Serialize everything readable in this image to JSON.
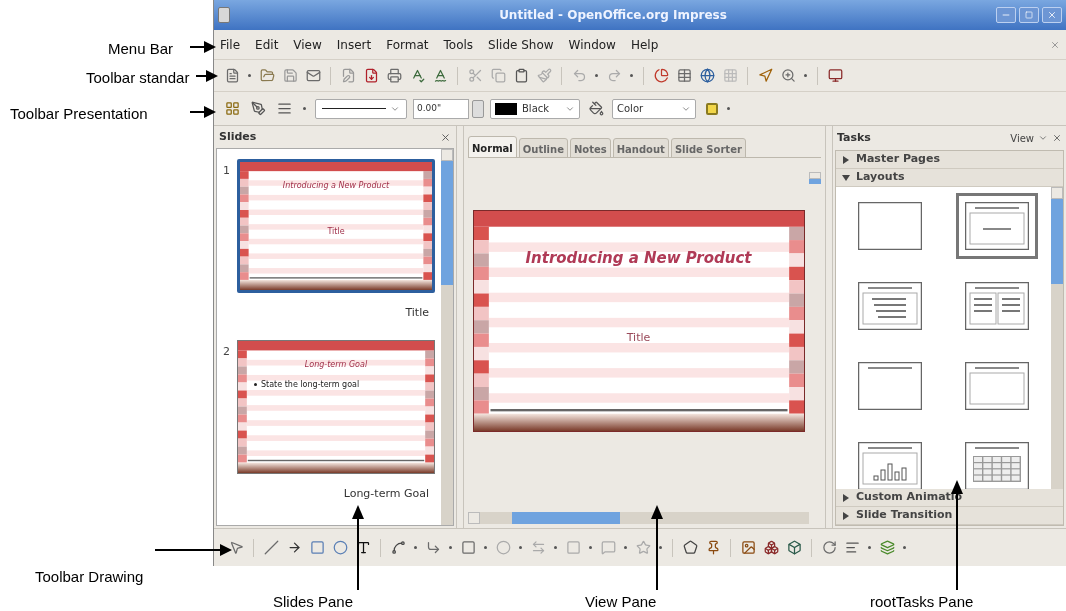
{
  "annotations": [
    {
      "label": "Menu Bar",
      "kind": "right"
    },
    {
      "label": "Toolbar standar",
      "kind": "right"
    },
    {
      "label": "Toolbar Presentation",
      "kind": "right"
    },
    {
      "label": "Toolbar Drawing",
      "kind": "right"
    },
    {
      "label": "Slides Pane",
      "kind": "up"
    },
    {
      "label": "View Pane",
      "kind": "up"
    },
    {
      "label": "rootTasks Pane",
      "kind": "up"
    }
  ],
  "window": {
    "title": "Untitled - OpenOffice.org Impress"
  },
  "menu": [
    "File",
    "Edit",
    "View",
    "Insert",
    "Format",
    "Tools",
    "Slide Show",
    "Window",
    "Help"
  ],
  "toolbar_presentation": {
    "line_width": "0.00\"",
    "line_color": "Black",
    "area_style": "Color"
  },
  "slides_pane": {
    "title": "Slides",
    "slides": [
      {
        "number": "1",
        "title": "Introducing a New Product",
        "body": "Title",
        "label": "Title",
        "kind": "title",
        "selected": true
      },
      {
        "number": "2",
        "title": "Long-term Goal",
        "body": "State the long-term goal",
        "label": "Long-term Goal",
        "kind": "bullets",
        "selected": false
      }
    ]
  },
  "view_pane": {
    "tabs": [
      {
        "label": "Normal",
        "selected": true
      },
      {
        "label": "Outline",
        "selected": false
      },
      {
        "label": "Notes",
        "selected": false
      },
      {
        "label": "Handout",
        "selected": false
      },
      {
        "label": "Slide Sorter",
        "selected": false
      }
    ],
    "slide": {
      "title": "Introducing a New Product",
      "subtitle": "Title"
    }
  },
  "tasks_pane": {
    "title": "Tasks",
    "view_menu": "View",
    "sections": [
      {
        "label": "Master Pages",
        "expanded": false
      },
      {
        "label": "Layouts",
        "expanded": true
      },
      {
        "label": "Custom Animatio",
        "expanded": false
      },
      {
        "label": "Slide Transition",
        "expanded": false
      }
    ],
    "layouts": [
      {
        "kind": "blank",
        "selected": false
      },
      {
        "kind": "title-centered",
        "selected": true
      },
      {
        "kind": "title-list",
        "selected": false
      },
      {
        "kind": "title-two-lists",
        "selected": false
      },
      {
        "kind": "title-only",
        "selected": false
      },
      {
        "kind": "title-box",
        "selected": false
      },
      {
        "kind": "title-chart",
        "selected": false
      },
      {
        "kind": "title-table",
        "selected": false
      }
    ]
  }
}
